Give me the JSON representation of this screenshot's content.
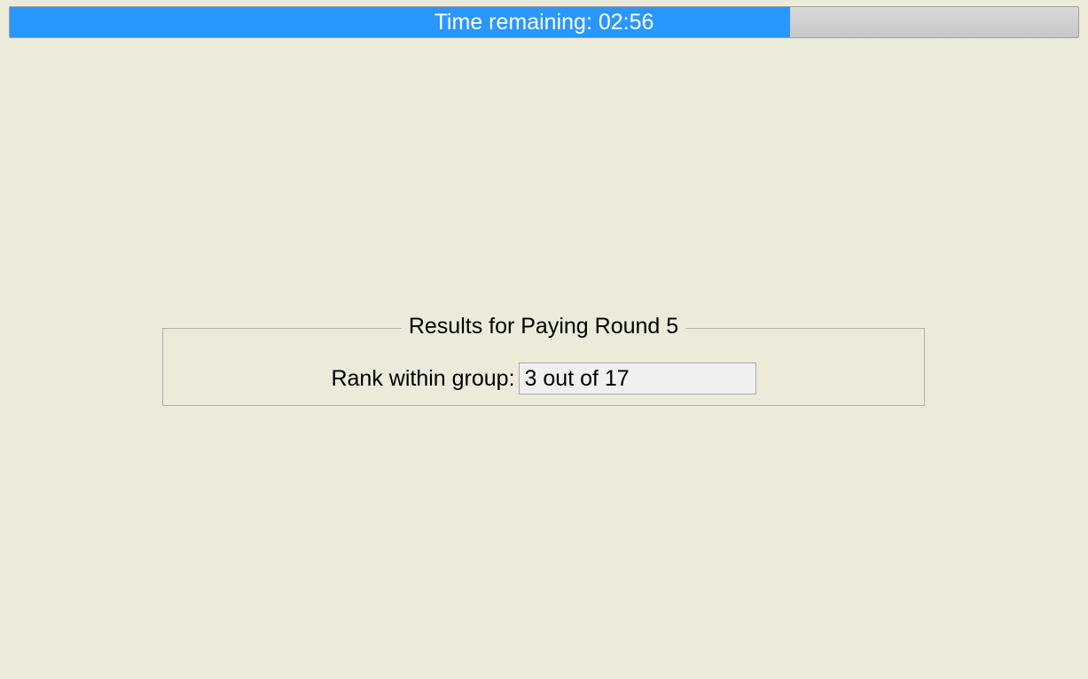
{
  "timer": {
    "label": "Time remaining: 02:56",
    "fill_percent": 73
  },
  "results": {
    "title": "Results for Paying Round 5",
    "rank_label": "Rank within group:",
    "rank_value": "3 out of 17"
  }
}
